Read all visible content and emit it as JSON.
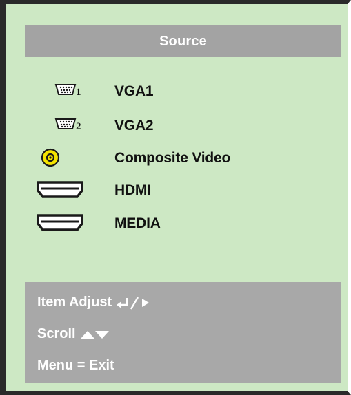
{
  "menu": {
    "title": "Source",
    "items": [
      {
        "label": "VGA1",
        "icon": "vga-1-icon"
      },
      {
        "label": "VGA2",
        "icon": "vga-2-icon"
      },
      {
        "label": "Composite Video",
        "icon": "composite-rca-icon"
      },
      {
        "label": "HDMI",
        "icon": "hdmi-icon"
      },
      {
        "label": "MEDIA",
        "icon": "hdmi-icon"
      }
    ]
  },
  "hints": {
    "item_adjust": "Item Adjust",
    "scroll": "Scroll",
    "menu_exit": "Menu = Exit"
  },
  "colors": {
    "panel_bg": "#cde8c4",
    "bar_gray": "#a3a3a3",
    "composite_yellow": "#f4e400"
  }
}
